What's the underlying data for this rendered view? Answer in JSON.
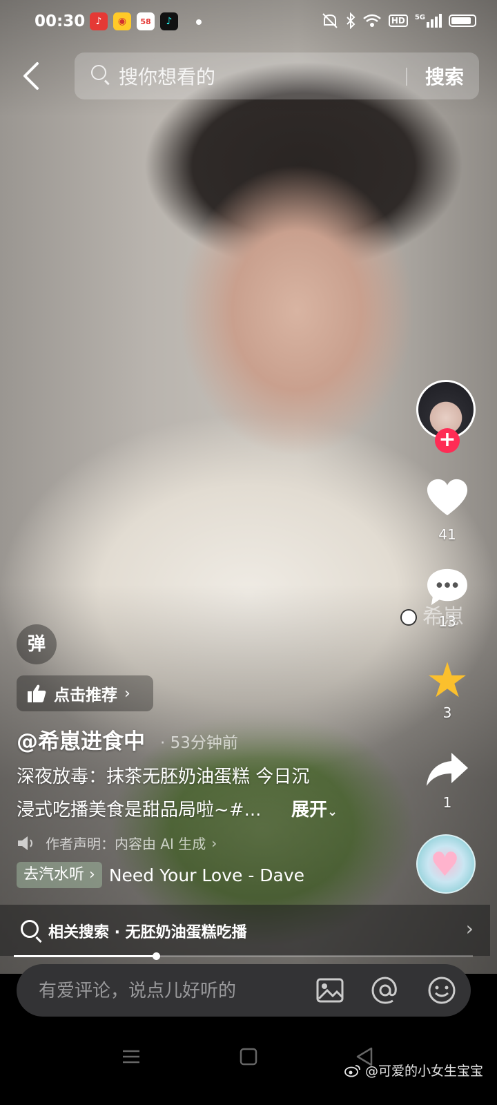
{
  "status_bar": {
    "time": "00:30",
    "app_icons": [
      {
        "name": "music-app-icon",
        "glyph": "♪",
        "color": "#e53935"
      },
      {
        "name": "weibo-app-icon",
        "glyph": "◉",
        "color": "#ffb300"
      },
      {
        "name": "58-app-icon",
        "glyph": "58",
        "color": "#ffffff"
      },
      {
        "name": "tiktok-app-icon",
        "glyph": "♪",
        "color": "#111111"
      }
    ],
    "hd_label": "HD",
    "signal_label": "5G"
  },
  "header": {
    "search_placeholder": "搜你想看的",
    "search_button": "搜索"
  },
  "sidebar": {
    "likes": "41",
    "comments": "13",
    "favorites": "3",
    "shares": "1",
    "overlay_text": "希崽",
    "colors": {
      "follow": "#fe2c55",
      "star": "#fbc02d"
    }
  },
  "video_info": {
    "danmu_label": "弹",
    "recommend_label": "点击推荐",
    "author": "@希崽进食中",
    "time_ago": "· 53分钟前",
    "description_line1": "深夜放毒：抹茶无胚奶油蛋糕 今日沉",
    "description_line2": "浸式吃播美食是甜品局啦~#...",
    "expand_label": "展开",
    "ai_notice": "作者声明：内容由 AI 生成",
    "music_tag": "去汽水听",
    "music_title": "Need Your Love - Dave"
  },
  "related_search": {
    "text": "相关搜索 · 无胚奶油蛋糕吃播"
  },
  "progress": {
    "played_fraction": 0.31
  },
  "comment_bar": {
    "placeholder": "有爱评论，说点儿好听的"
  },
  "watermark": {
    "text": "@可爱的小女生宝宝"
  }
}
